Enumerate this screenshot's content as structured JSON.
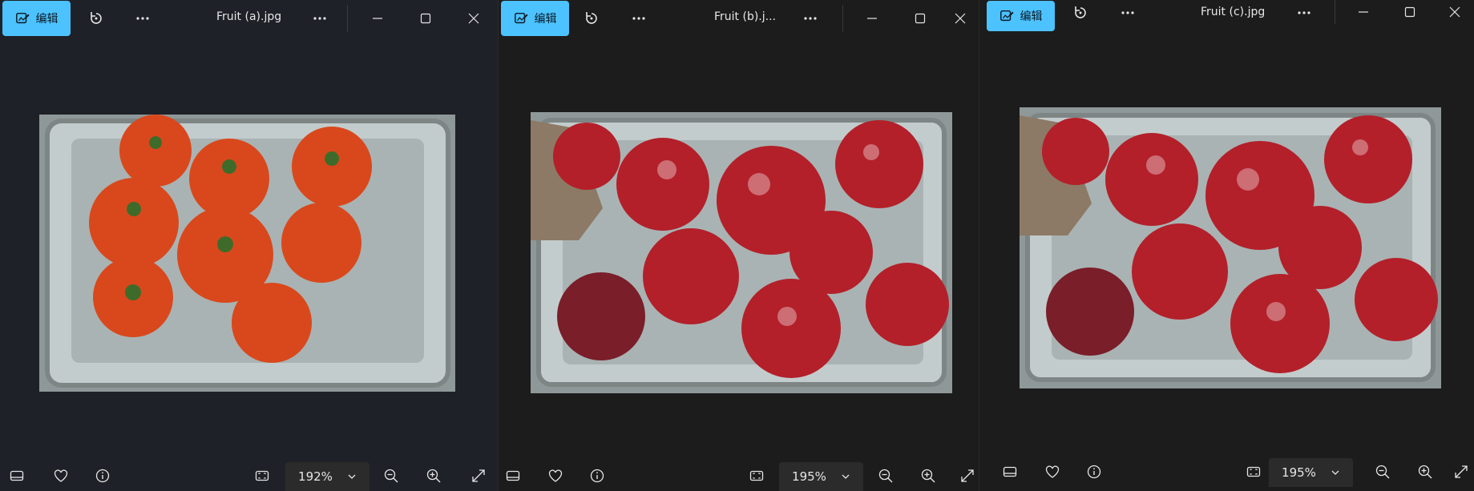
{
  "windows": [
    {
      "id": "a",
      "edit_label": "编辑",
      "title": "Fruit (a).jpg",
      "zoom": "192%",
      "image_description_colors": {
        "fruit": "#d9481c",
        "tray": "#b8c4c4"
      }
    },
    {
      "id": "b",
      "edit_label": "编辑",
      "title": "Fruit (b).j...",
      "zoom": "195%",
      "image_description_colors": {
        "fruit": "#b3202a",
        "tray": "#b8c4c4"
      }
    },
    {
      "id": "c",
      "edit_label": "编辑",
      "title": "Fruit (c).jpg",
      "zoom": "195%",
      "image_description_colors": {
        "fruit": "#b3202a",
        "tray": "#b8c4c4"
      }
    }
  ],
  "icons": {
    "edit": "edit-image-icon",
    "rotate": "rotate-icon",
    "more": "more-icon",
    "minimize": "minimize-icon",
    "maximize": "maximize-icon",
    "close": "close-icon",
    "filmstrip": "filmstrip-icon",
    "favorite": "heart-icon",
    "info": "info-icon",
    "fit": "fit-to-window-icon",
    "zoom_out": "zoom-out-icon",
    "zoom_in": "zoom-in-icon",
    "fullscreen": "fullscreen-icon"
  },
  "colors": {
    "accent": "#4cc2ff",
    "background_a": "#1e2128",
    "background": "#1c1c1c"
  }
}
